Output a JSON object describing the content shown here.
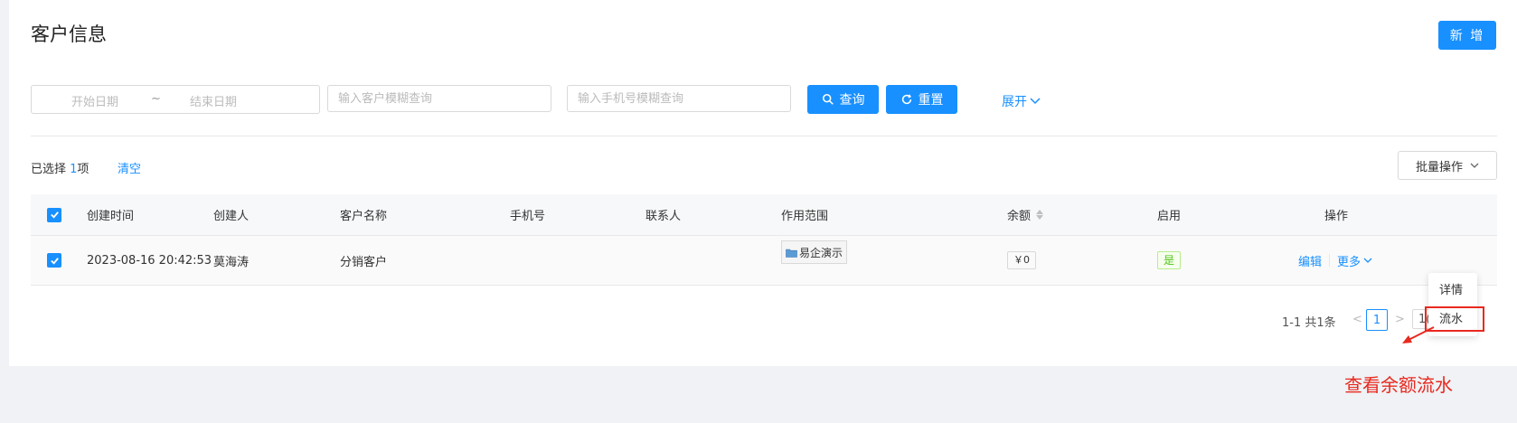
{
  "header": {
    "title": "客户信息",
    "new_button": "新 增"
  },
  "filters": {
    "start_date_placeholder": "开始日期",
    "range_separator": "~",
    "end_date_placeholder": "结束日期",
    "customer_placeholder": "输入客户模糊查询",
    "phone_placeholder": "输入手机号模糊查询",
    "search_button": "查询",
    "reset_button": "重置",
    "expand_link": "展开"
  },
  "selection": {
    "prefix": "已选择 ",
    "count": "1",
    "suffix": "项",
    "clear": "清空",
    "batch_button": "批量操作"
  },
  "table": {
    "columns": [
      "创建时间",
      "创建人",
      "客户名称",
      "手机号",
      "联系人",
      "作用范围",
      "余额",
      "启用",
      "操作"
    ],
    "rows": [
      {
        "created_at": "2023-08-16 20:42:53",
        "creator": "莫海涛",
        "customer_name": "分销客户",
        "phone": "",
        "contact": "",
        "scope": "易企演示",
        "balance": "￥0",
        "enabled": "是",
        "edit": "编辑",
        "more": "更多"
      }
    ]
  },
  "pagination": {
    "total": "1-1 共1条",
    "prev": "<",
    "current": "1",
    "next": ">",
    "size_partial": "1("
  },
  "dropdown": {
    "items": [
      "详情",
      "流水"
    ]
  },
  "annotation": {
    "text": "查看余额流水"
  },
  "colors": {
    "primary": "#1890ff",
    "annotation": "#e8291f",
    "enabled": "#52c41a"
  }
}
